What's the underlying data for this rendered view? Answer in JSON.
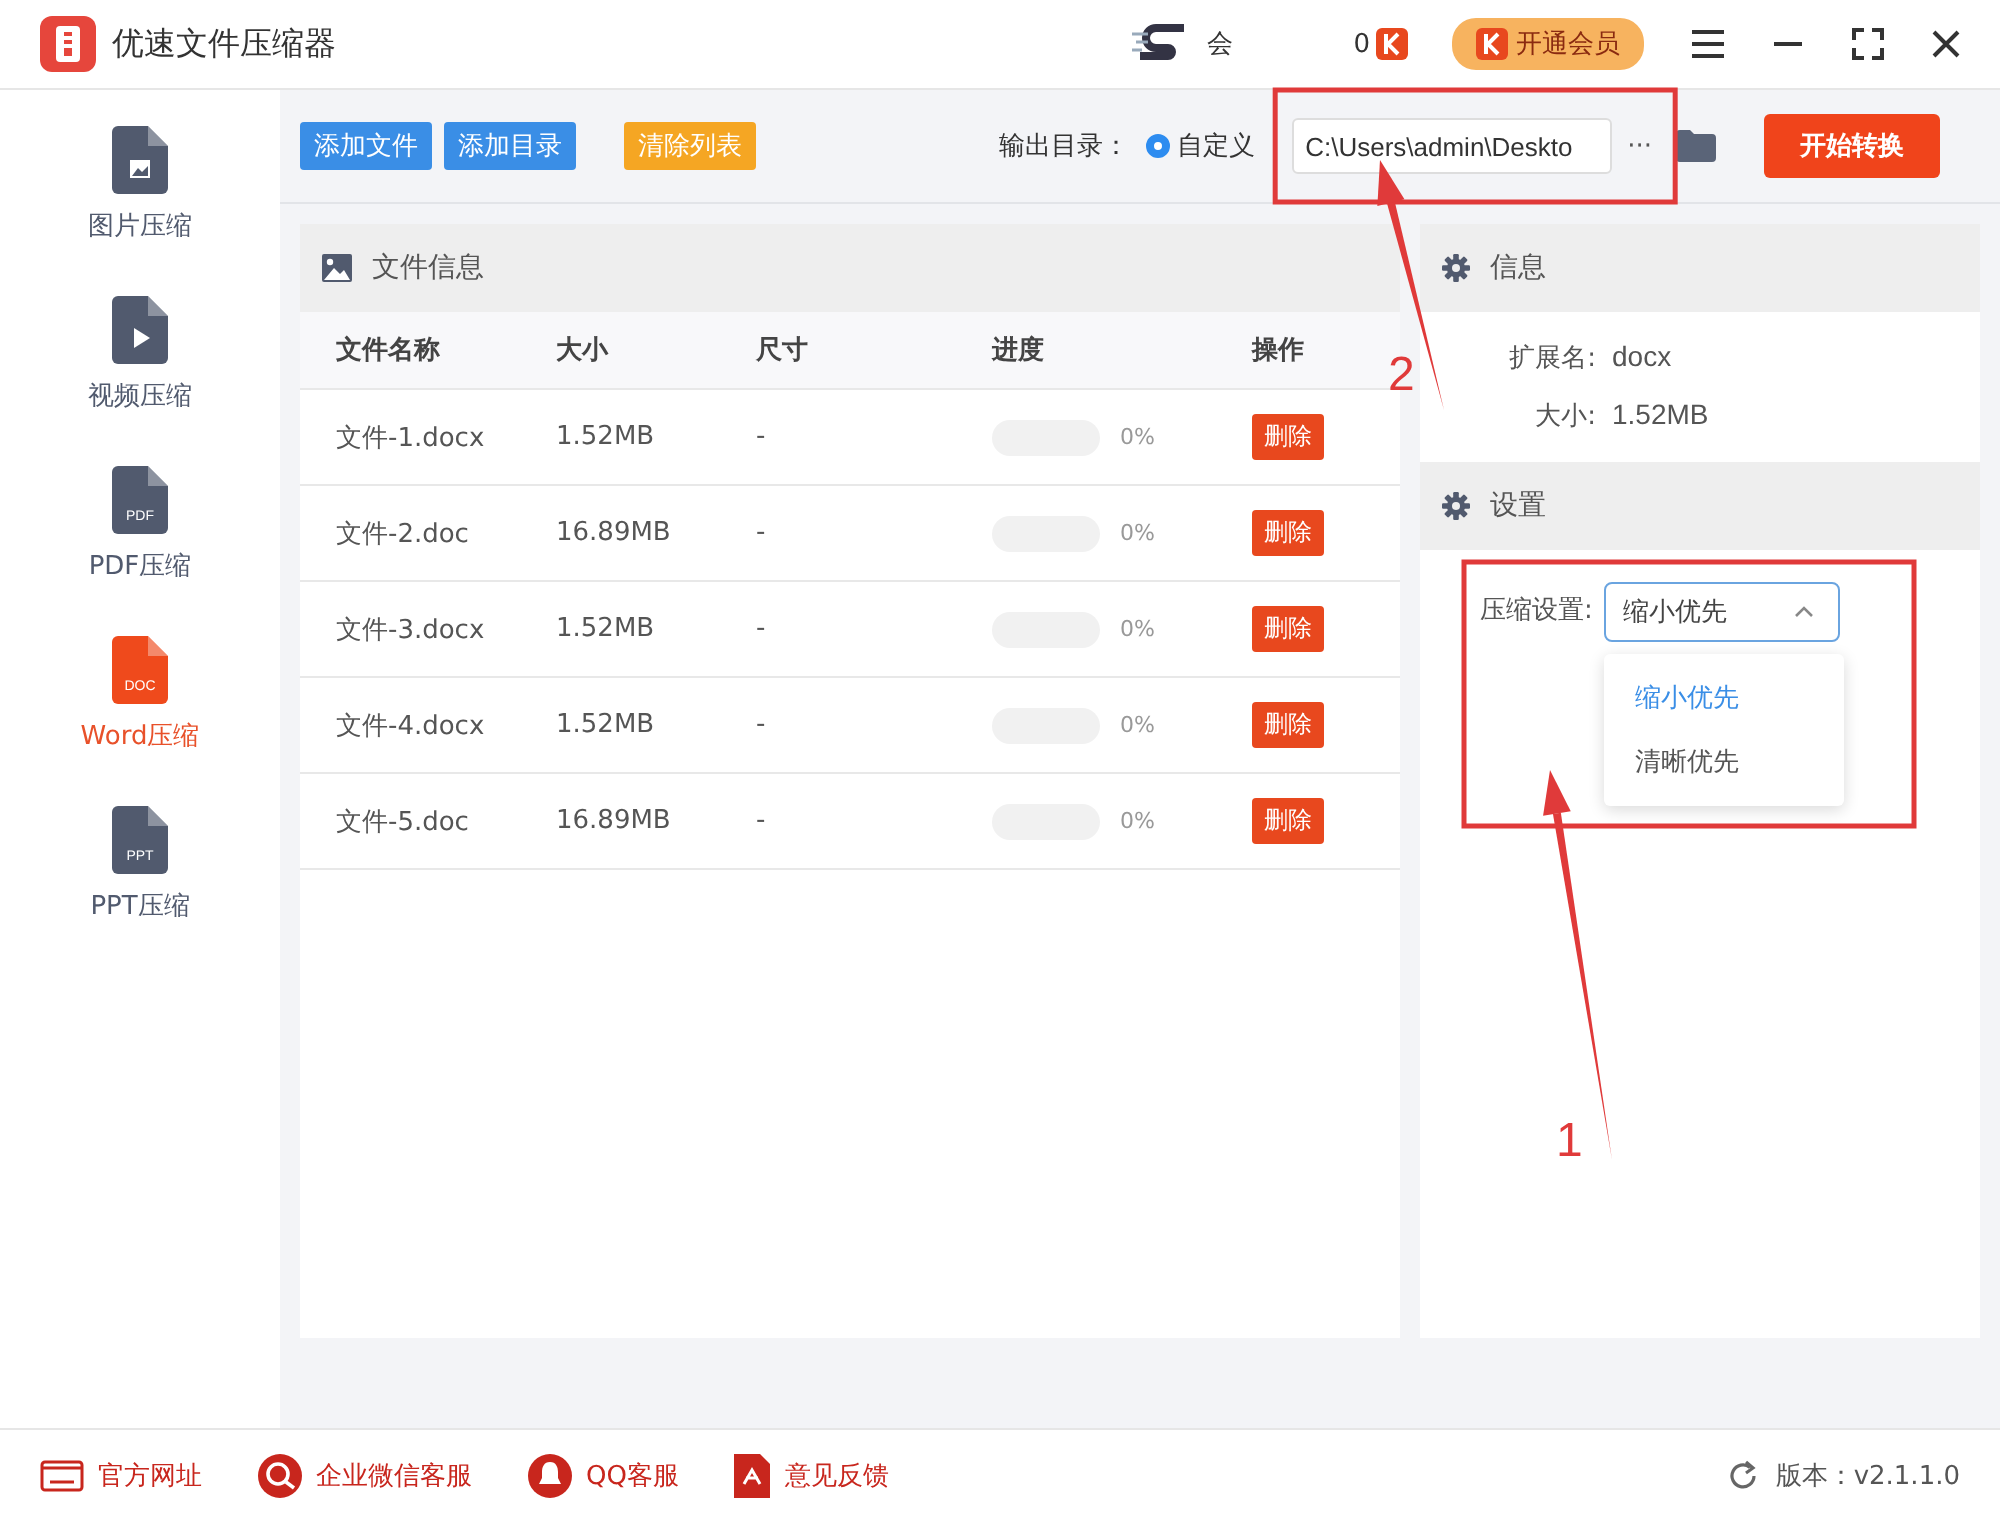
{
  "window": {
    "title": "优速文件压缩器"
  },
  "header": {
    "member_text": "会",
    "coin_count": "0",
    "vip_button": "开通会员"
  },
  "toolbar": {
    "buttons": [
      {
        "label": "添加文件",
        "kind": "primary"
      },
      {
        "label": "添加目录",
        "kind": "primary"
      },
      {
        "label": "清除列表",
        "kind": "warning"
      }
    ],
    "output_label": "输出目录：",
    "radio": {
      "label": "自定义",
      "selected": true
    },
    "path": "C:\\Users\\admin\\Deskto",
    "more": "···",
    "start_button": "开始转换"
  },
  "sidebar": {
    "items": [
      {
        "label": "图片压缩",
        "kind": "image",
        "selected": false
      },
      {
        "label": "视频压缩",
        "kind": "video",
        "selected": false
      },
      {
        "label": "PDF压缩",
        "kind": "text",
        "badge": "PDF",
        "selected": false
      },
      {
        "label": "Word压缩",
        "kind": "text",
        "badge": "DOC",
        "selected": true
      },
      {
        "label": "PPT压缩",
        "kind": "text",
        "badge": "PPT",
        "selected": false
      }
    ]
  },
  "file_panel": {
    "title": "文件信息",
    "columns": [
      "文件名称",
      "大小",
      "尺寸",
      "进度",
      "操作"
    ],
    "rows": [
      {
        "name": "文件-1.docx",
        "size": "1.52MB",
        "dimension": "-",
        "level": 0,
        "reading": "0%",
        "action": "删除"
      },
      {
        "name": "文件-2.doc",
        "size": "16.89MB",
        "dimension": "-",
        "level": 0,
        "reading": "0%",
        "action": "删除"
      },
      {
        "name": "文件-3.docx",
        "size": "1.52MB",
        "dimension": "-",
        "level": 0,
        "reading": "0%",
        "action": "删除"
      },
      {
        "name": "文件-4.docx",
        "size": "1.52MB",
        "dimension": "-",
        "level": 0,
        "reading": "0%",
        "action": "删除"
      },
      {
        "name": "文件-5.doc",
        "size": "16.89MB",
        "dimension": "-",
        "level": 0,
        "reading": "0%",
        "action": "删除"
      }
    ]
  },
  "info_panel": {
    "title": "信息",
    "fields": [
      {
        "label": "扩展名:",
        "value": "docx"
      },
      {
        "label": "大小:",
        "value": "1.52MB"
      }
    ]
  },
  "settings_panel": {
    "title": "设置",
    "label": "压缩设置:",
    "select": {
      "value": "缩小优先",
      "expanded": true
    },
    "options": [
      {
        "label": "缩小优先",
        "selected": true
      },
      {
        "label": "清晰优先",
        "selected": false
      }
    ]
  },
  "footer": {
    "links": [
      {
        "label": "官方网址",
        "kind": "web"
      },
      {
        "label": "企业微信客服",
        "kind": "chat"
      },
      {
        "label": "QQ客服",
        "kind": "qq"
      },
      {
        "label": "意见反馈",
        "kind": "feedback"
      }
    ],
    "version": "版本：v2.1.1.0"
  },
  "annotations": [
    {
      "label": "1"
    },
    {
      "label": "2"
    }
  ]
}
